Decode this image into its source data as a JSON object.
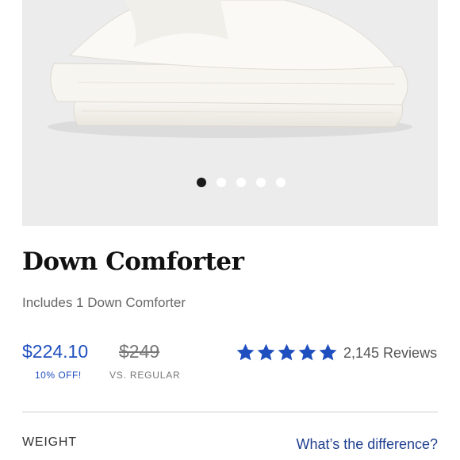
{
  "product": {
    "image_alt": "White folded down comforter",
    "carousel_total": 5,
    "carousel_active": 1,
    "name": "Down Comforter",
    "includes": "Includes 1 Down Comforter",
    "price": "$224.10",
    "discount": "10% OFF!",
    "regular_price": "$249",
    "regular_label": "VS. REGULAR",
    "rating": 5,
    "reviews": "2,145 Reviews"
  },
  "options": {
    "weight_label": "WEIGHT",
    "difference_link": "What’s the difference?"
  },
  "colors": {
    "accent": "#1f4fbf",
    "star": "#1f4fbf",
    "hero_bg": "#ececec"
  }
}
